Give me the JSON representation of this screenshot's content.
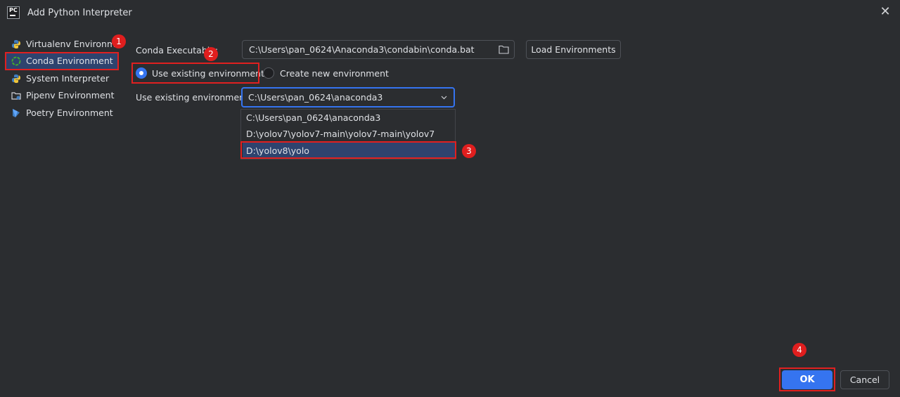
{
  "window": {
    "title": "Add Python Interpreter",
    "app_icon_text": "PC"
  },
  "sidebar": {
    "items": [
      {
        "label": "Virtualenv Environment",
        "icon": "python-icon"
      },
      {
        "label": "Conda Environment",
        "icon": "conda-icon"
      },
      {
        "label": "System Interpreter",
        "icon": "python-icon"
      },
      {
        "label": "Pipenv Environment",
        "icon": "pipenv-icon"
      },
      {
        "label": "Poetry Environment",
        "icon": "poetry-icon"
      }
    ]
  },
  "form": {
    "conda_executable_label": "Conda Executable:",
    "conda_executable_value": "C:\\Users\\pan_0624\\Anaconda3\\condabin\\conda.bat",
    "load_environments_label": "Load Environments",
    "radio_existing_label": "Use existing environment",
    "radio_new_label": "Create new environment",
    "existing_env_label": "Use existing environment:",
    "existing_env_value": "C:\\Users\\pan_0624\\anaconda3",
    "env_options": [
      "C:\\Users\\pan_0624\\anaconda3",
      "D:\\yolov7\\yolov7-main\\yolov7-main\\yolov7",
      "D:\\yolov8\\yolo"
    ]
  },
  "annotations": [
    "1",
    "2",
    "3",
    "4"
  ],
  "footer": {
    "ok_label": "OK",
    "cancel_label": "Cancel"
  },
  "colors": {
    "background": "#2b2d30",
    "accent": "#3574f0",
    "selection": "#2e436e",
    "annotation_red": "#e02020"
  }
}
